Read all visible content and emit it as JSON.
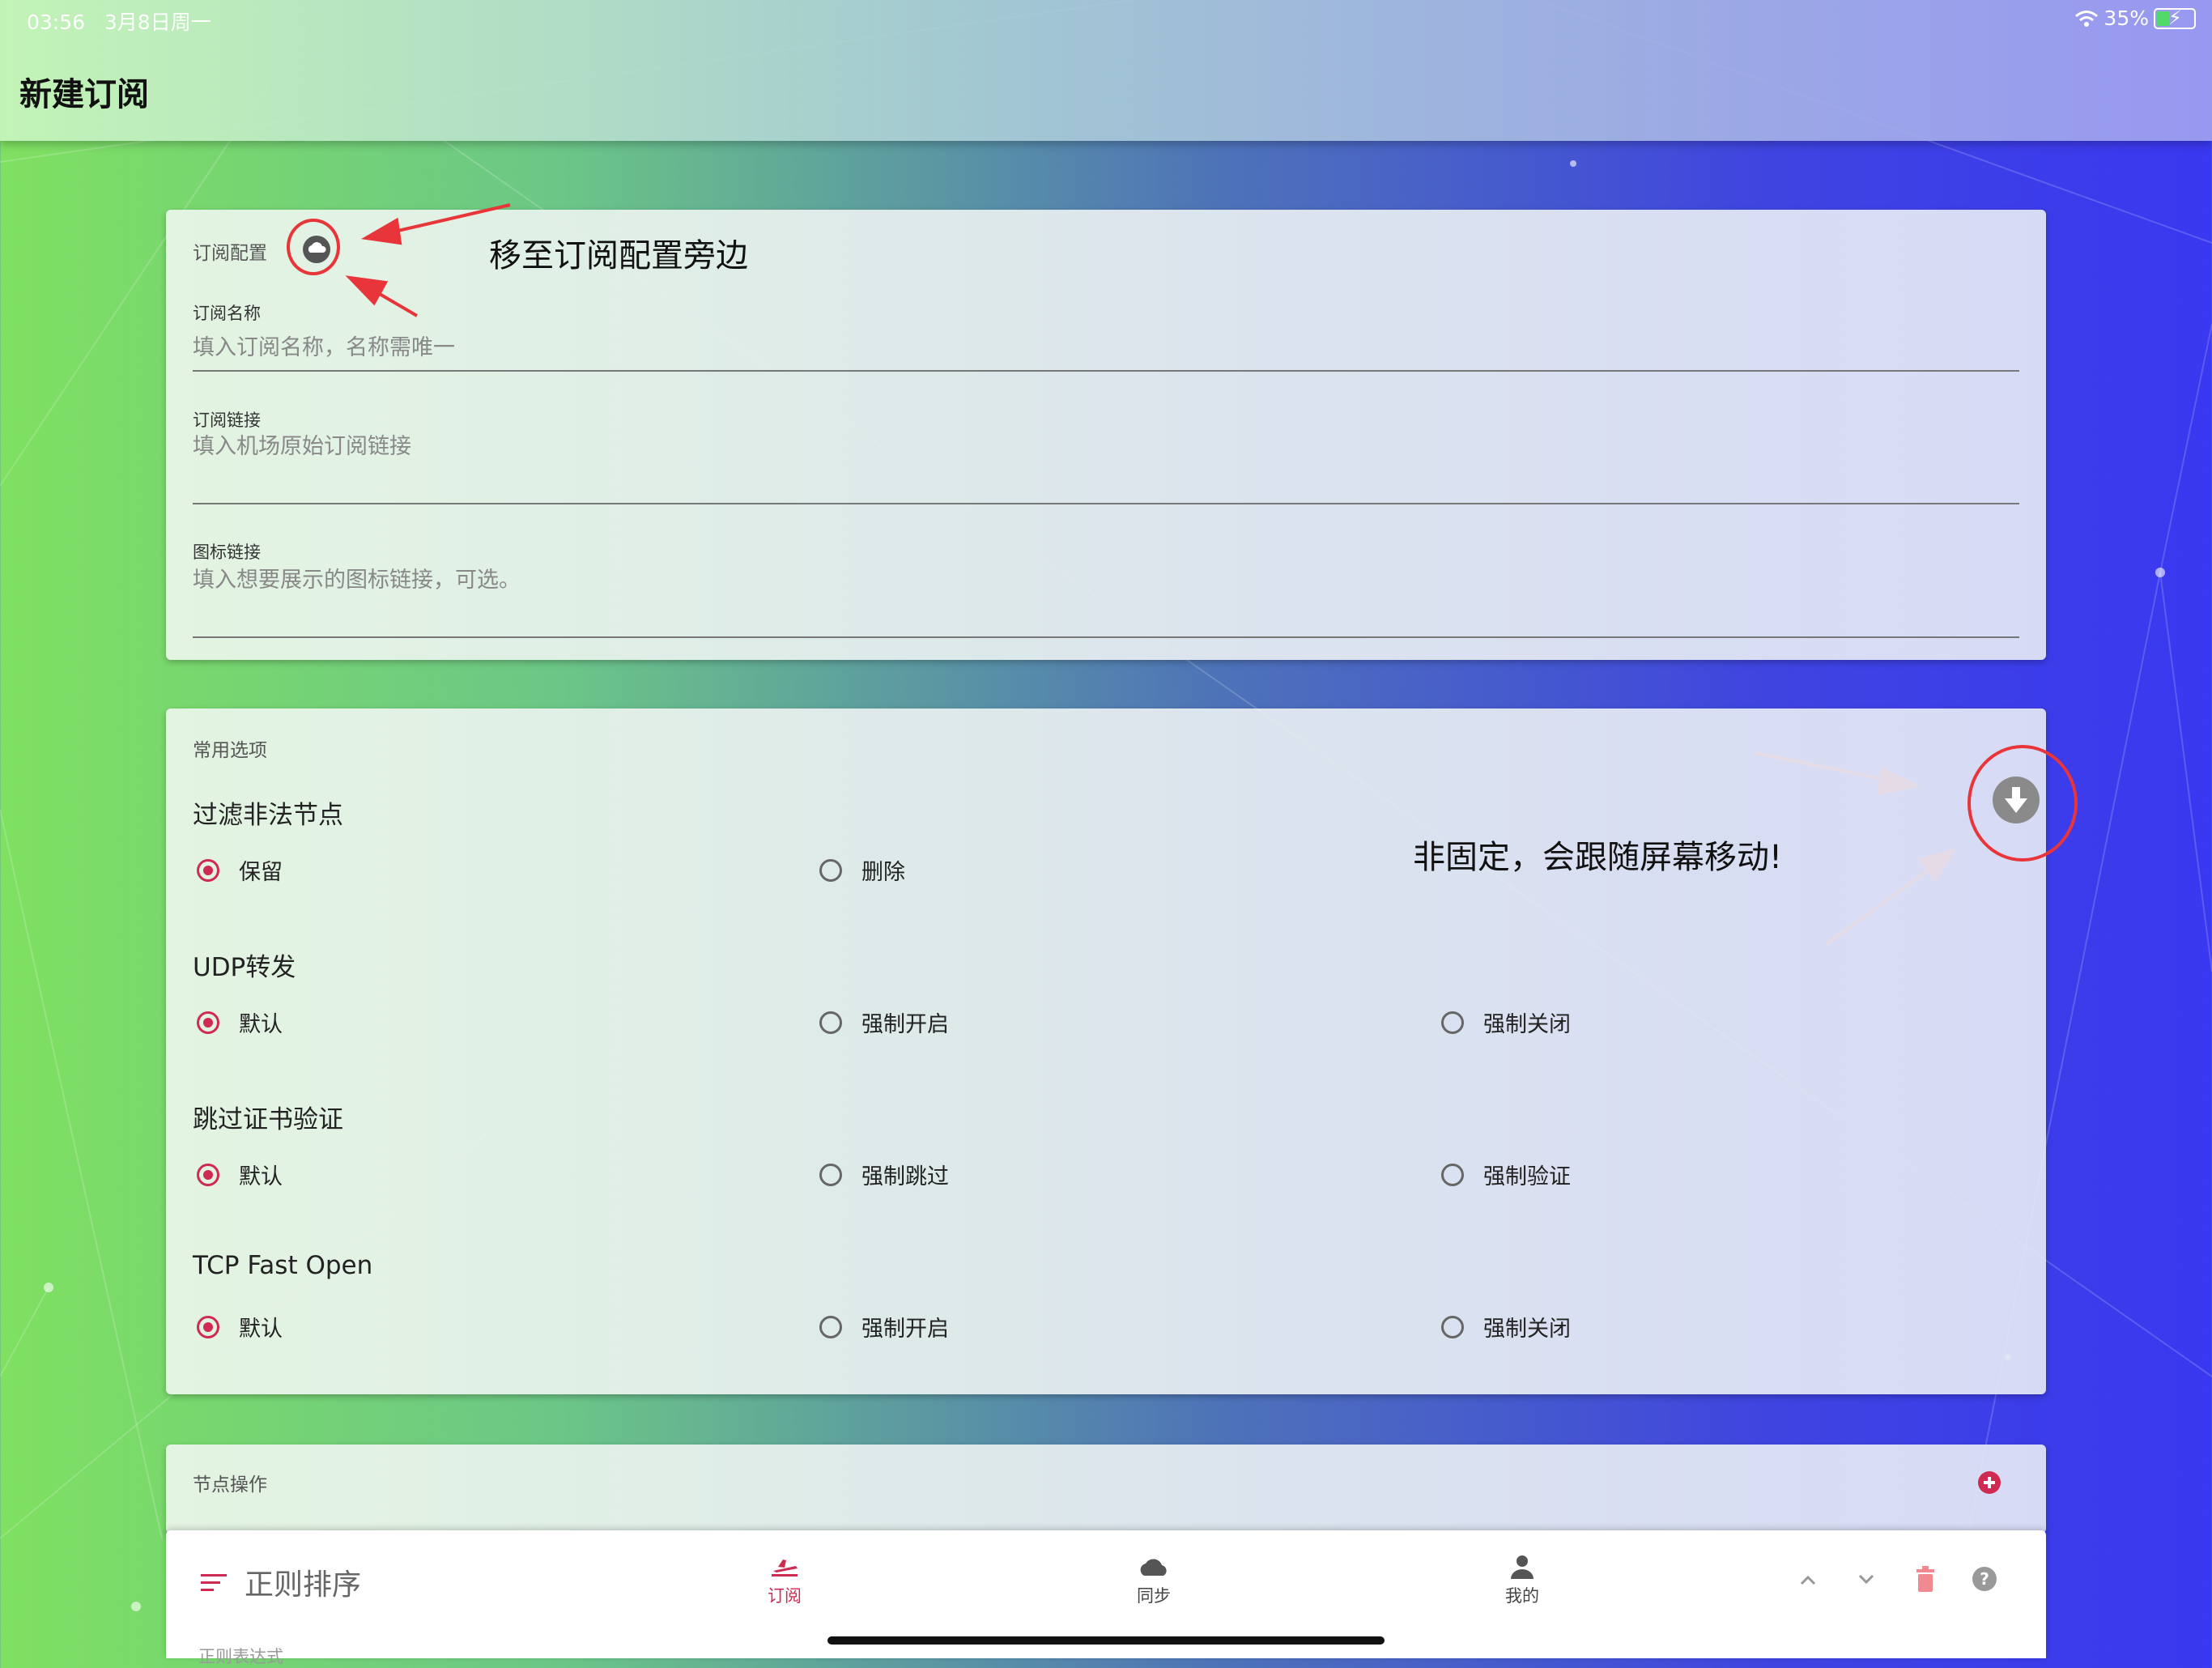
{
  "status_bar": {
    "time": "03:56",
    "date": "3月8日周一",
    "battery_percent": "35%",
    "battery_level": 0.35
  },
  "header": {
    "title": "新建订阅"
  },
  "subscription_config": {
    "title": "订阅配置",
    "name_label": "订阅名称",
    "name_placeholder": "填入订阅名称，名称需唯一",
    "url_label": "订阅链接",
    "url_placeholder": "填入机场原始订阅链接",
    "icon_label": "图标链接",
    "icon_placeholder": "填入想要展示的图标链接，可选。"
  },
  "common_options": {
    "title": "常用选项",
    "groups": [
      {
        "title": "过滤非法节点",
        "options": [
          "保留",
          "删除"
        ],
        "selected": 0
      },
      {
        "title": "UDP转发",
        "options": [
          "默认",
          "强制开启",
          "强制关闭"
        ],
        "selected": 0
      },
      {
        "title": "跳过证书验证",
        "options": [
          "默认",
          "强制跳过",
          "强制验证"
        ],
        "selected": 0
      },
      {
        "title": "TCP Fast Open",
        "options": [
          "默认",
          "强制开启",
          "强制关闭"
        ],
        "selected": 0
      }
    ]
  },
  "node_ops": {
    "title": "节点操作"
  },
  "annotations": {
    "move_note": "移至订阅配置旁边",
    "float_note": "非固定，会跟随屏幕移动!"
  },
  "bottom_bar": {
    "section_title": "正则排序",
    "sub_text": "正则表达式",
    "tabs": [
      {
        "label": "订阅",
        "active": true
      },
      {
        "label": "同步",
        "active": false
      },
      {
        "label": "我的",
        "active": false
      }
    ]
  },
  "colors": {
    "accent": "#cf2a52",
    "annotation": "#e8353a"
  }
}
